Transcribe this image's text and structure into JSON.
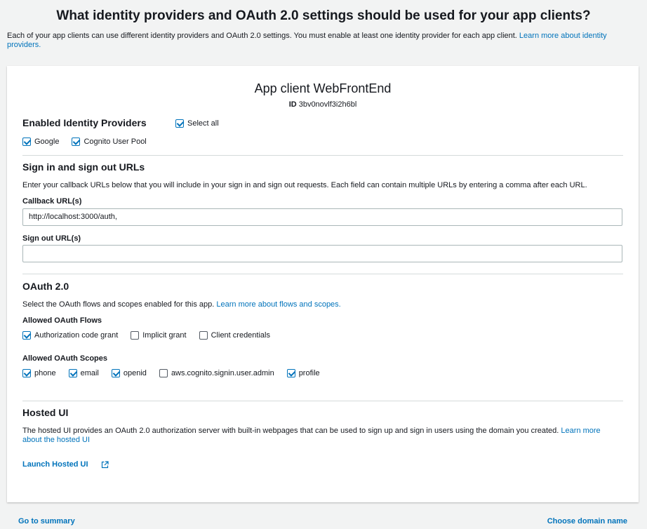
{
  "page": {
    "heading": "What identity providers and OAuth 2.0 settings should be used for your app clients?",
    "intro_text": "Each of your app clients can use different identity providers and OAuth 2.0 settings. You must enable at least one identity provider for each app client.",
    "intro_link": "Learn more about identity providers."
  },
  "client": {
    "title_prefix": "App client",
    "name": "WebFrontEnd",
    "id_label": "ID",
    "id_value": "3bv0novlf3i2h6bl"
  },
  "providers": {
    "title": "Enabled Identity Providers",
    "select_all": {
      "label": "Select all",
      "checked": true
    },
    "items": [
      {
        "label": "Google",
        "checked": true
      },
      {
        "label": "Cognito User Pool",
        "checked": true
      }
    ]
  },
  "urls": {
    "title": "Sign in and sign out URLs",
    "description": "Enter your callback URLs below that you will include in your sign in and sign out requests. Each field can contain multiple URLs by entering a comma after each URL.",
    "callback_label": "Callback URL(s)",
    "callback_value": "http://localhost:3000/auth,",
    "signout_label": "Sign out URL(s)",
    "signout_value": ""
  },
  "oauth": {
    "title": "OAuth 2.0",
    "description": "Select the OAuth flows and scopes enabled for this app.",
    "description_link": "Learn more about flows and scopes.",
    "flows_label": "Allowed OAuth Flows",
    "flows": [
      {
        "label": "Authorization code grant",
        "checked": true
      },
      {
        "label": "Implicit grant",
        "checked": false
      },
      {
        "label": "Client credentials",
        "checked": false
      }
    ],
    "scopes_label": "Allowed OAuth Scopes",
    "scopes": [
      {
        "label": "phone",
        "checked": true
      },
      {
        "label": "email",
        "checked": true
      },
      {
        "label": "openid",
        "checked": true
      },
      {
        "label": "aws.cognito.signin.user.admin",
        "checked": false
      },
      {
        "label": "profile",
        "checked": true
      }
    ]
  },
  "hosted_ui": {
    "title": "Hosted UI",
    "description": "The hosted UI provides an OAuth 2.0 authorization server with built-in webpages that can be used to sign up and sign in users using the domain you created.",
    "description_link": "Learn more about the hosted UI",
    "launch_label": "Launch Hosted UI",
    "launch_icon": "external-link-icon"
  },
  "footer": {
    "left_link": "Go to summary",
    "right_link": "Choose domain name"
  },
  "colors": {
    "link": "#0073bb",
    "background": "#f2f3f3",
    "card": "#ffffff",
    "divider": "#d5dbdb"
  }
}
